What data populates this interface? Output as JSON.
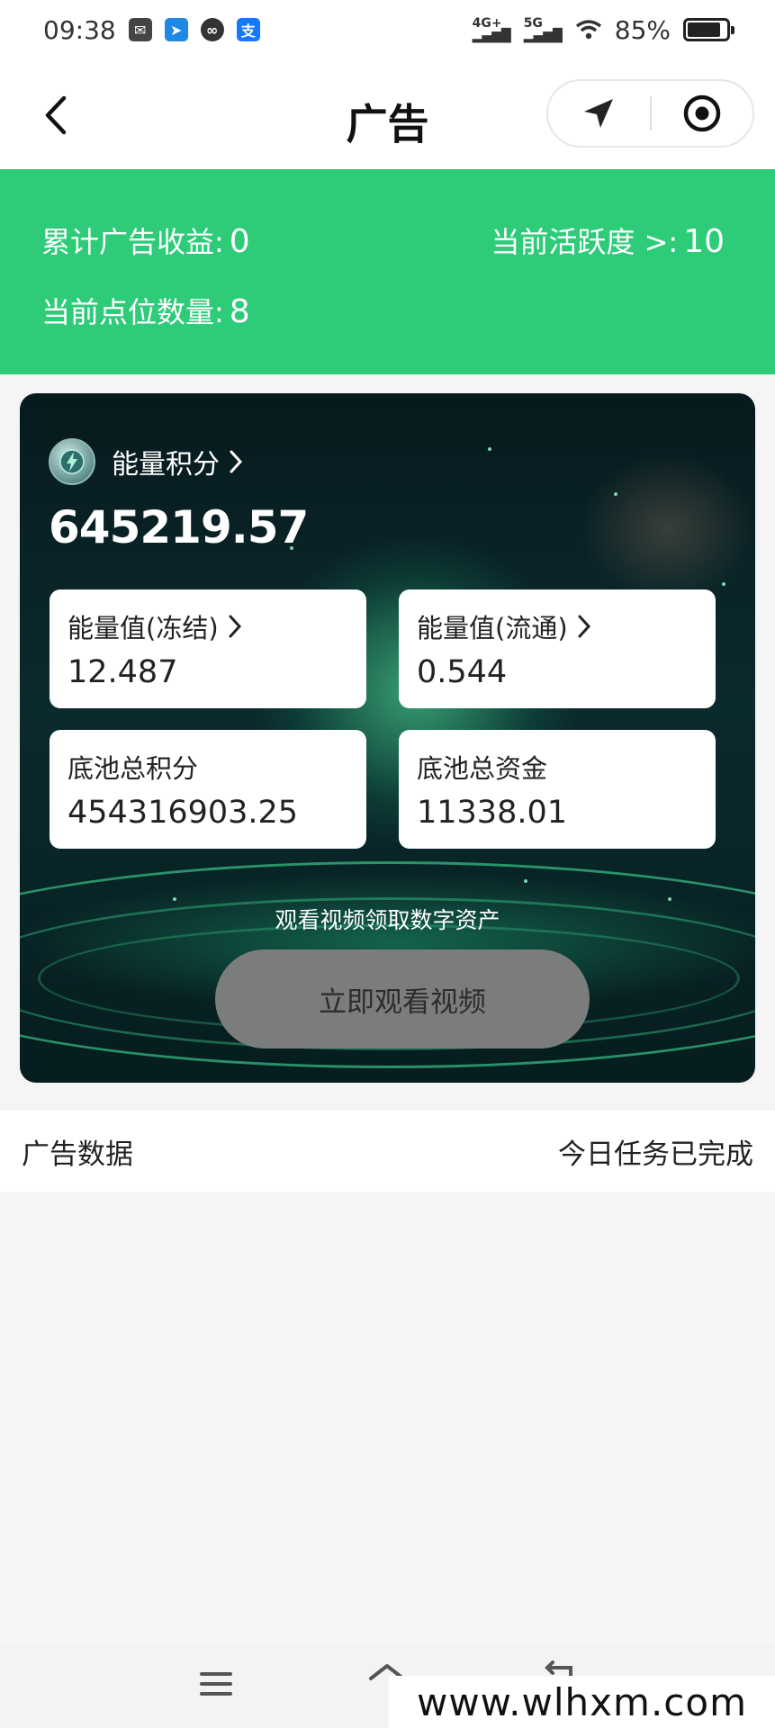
{
  "status_bar": {
    "time": "09:38",
    "network_1": "4G+",
    "network_2": "5G",
    "battery": "85%",
    "battery_level": 0.85
  },
  "nav": {
    "title": "广告"
  },
  "summary": {
    "ad_income_label": "累计广告收益:",
    "ad_income_value": "0",
    "activity_label": "当前活跃度 >:",
    "activity_value": "10",
    "points_label": "当前点位数量:",
    "points_value": "8"
  },
  "energy_card": {
    "title": "能量积分",
    "total": "645219.57",
    "stats": [
      {
        "label": "能量值(冻结)",
        "value": "12.487"
      },
      {
        "label": "能量值(流通)",
        "value": "0.544"
      },
      {
        "label": "底池总积分",
        "value": "454316903.25"
      },
      {
        "label": "底池总资金",
        "value": "11338.01"
      }
    ],
    "caption": "观看视频领取数字资产",
    "button_label": "立即观看视频"
  },
  "ad_data": {
    "label": "广告数据",
    "status": "今日任务已完成"
  },
  "watermark": "www.wlhxm.com",
  "colors": {
    "accent_green": "#2ecb79",
    "button_gray": "#7a7d7c"
  }
}
